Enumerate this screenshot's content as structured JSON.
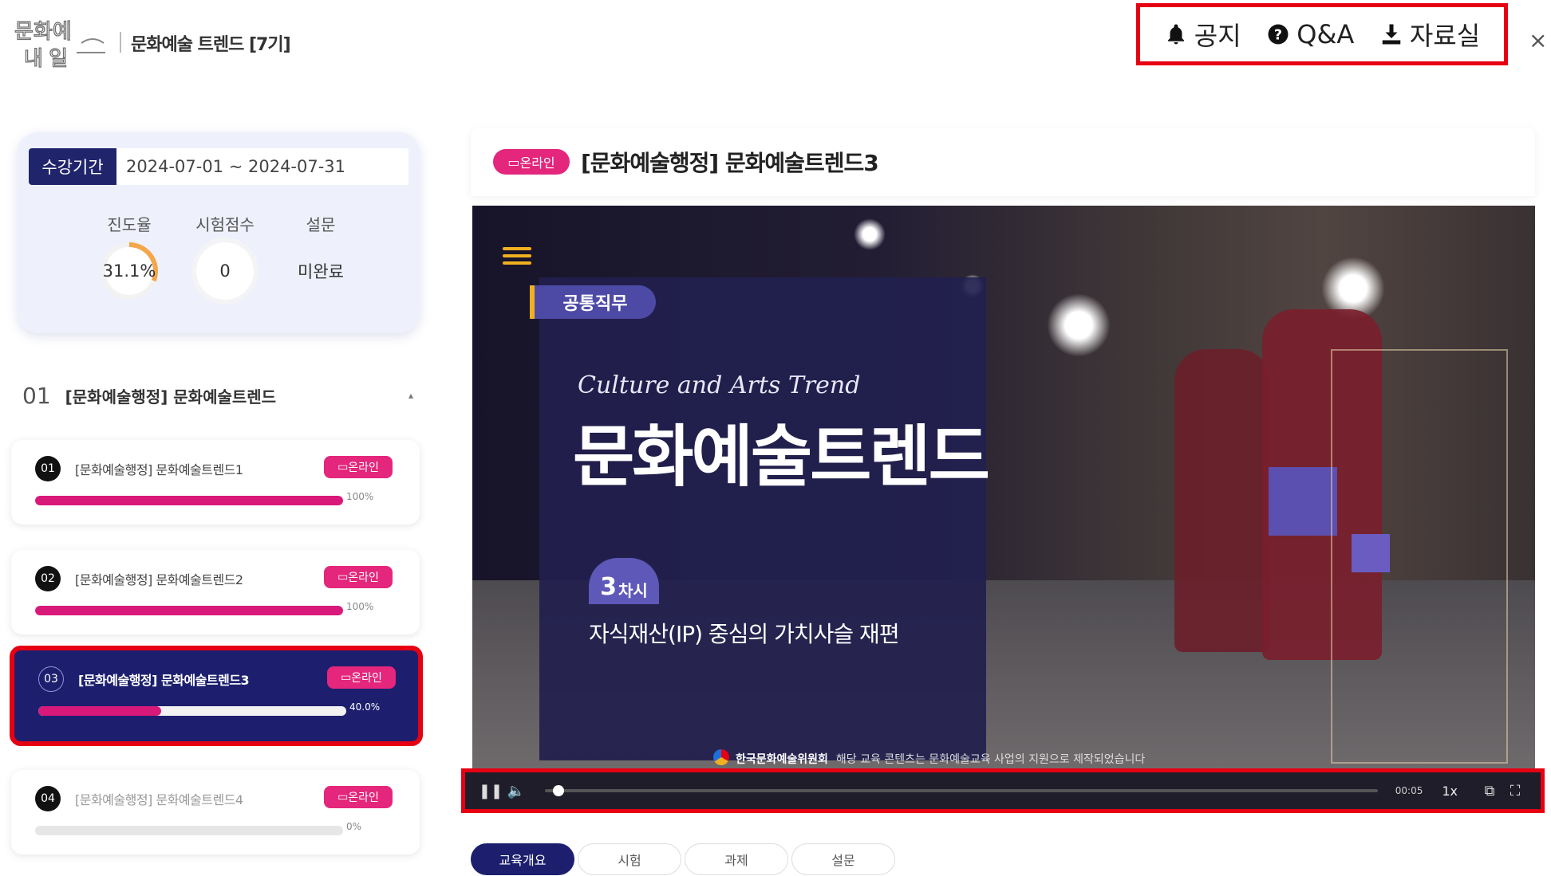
{
  "header": {
    "logo_text": "문화예술 내 일",
    "course_title": "문화예술 트렌드 [7기]",
    "menu": [
      {
        "label": "공지",
        "icon": "bell-icon"
      },
      {
        "label": "Q&A",
        "icon": "question-circle-icon"
      },
      {
        "label": "자료실",
        "icon": "download-icon"
      }
    ],
    "close_label": "×"
  },
  "summary": {
    "period_label": "수강기간",
    "period_value": "2024-07-01 ~ 2024-07-31",
    "stats": [
      {
        "label": "진도율",
        "value": "31.1%"
      },
      {
        "label": "시험점수",
        "value": "0"
      },
      {
        "label": "설문",
        "value": "미완료"
      }
    ]
  },
  "chapter": {
    "number": "01",
    "title": "[문화예술행정] 문화예술트렌드",
    "toggle": "▴"
  },
  "lessons": [
    {
      "num": "01",
      "title": "[문화예술행정] 문화예술트렌드1",
      "tag": "온라인",
      "progress": 100,
      "pct_label": "100%"
    },
    {
      "num": "02",
      "title": "[문화예술행정] 문화예술트렌드2",
      "tag": "온라인",
      "progress": 100,
      "pct_label": "100%"
    },
    {
      "num": "03",
      "title": "[문화예술행정] 문화예술트렌드3",
      "tag": "온라인",
      "progress": 40,
      "pct_label": "40.0%"
    },
    {
      "num": "04",
      "title": "[문화예술행정] 문화예술트렌드4",
      "tag": "온라인",
      "progress": 0,
      "pct_label": "0%"
    }
  ],
  "video": {
    "tag": "온라인",
    "title": "[문화예술행정] 문화예술트렌드3",
    "slide": {
      "category": "공통직무",
      "script_text": "Culture and Arts Trend",
      "main_title": "문화예술트렌드",
      "session_number": "3",
      "session_unit": "차시",
      "subtitle": "자식재산(IP) 중심의 가치사슬 재편",
      "footer_org": "한국문화예술위원회",
      "footer_note": "해당 교육 콘텐츠는 문화예술교육 사업의 지원으로 제작되었습니다"
    },
    "controls": {
      "time": "00:05",
      "speed": "1x",
      "progress": 0.01
    }
  },
  "tabs": [
    "교육개요",
    "시험",
    "과제",
    "설문"
  ],
  "colors": {
    "accent_pink": "#e4267c",
    "navy": "#1d1f6e",
    "highlight_red": "#e60012"
  }
}
